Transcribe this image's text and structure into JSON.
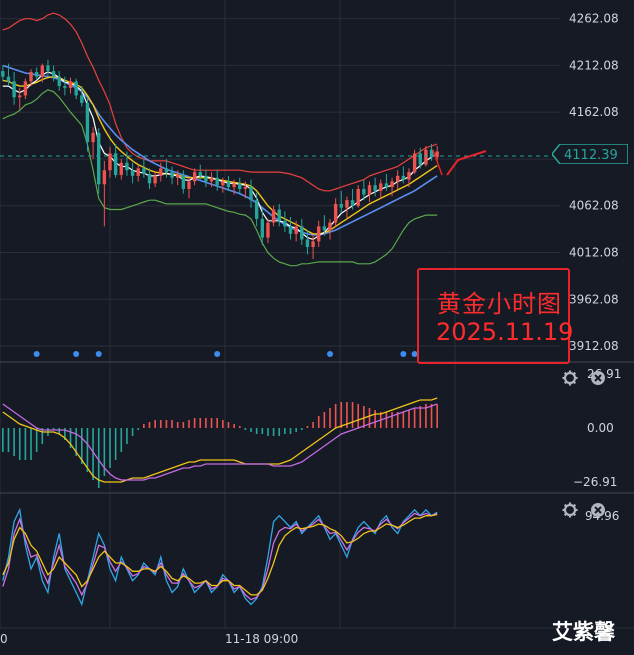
{
  "chart_data": [
    {
      "type": "line",
      "panel": "price",
      "subtitle": "",
      "price_axis_labels": [
        "4262.08",
        "4212.08",
        "4162.08",
        "4112.08",
        "4062.08",
        "4012.08",
        "3962.08",
        "3912.08"
      ],
      "price_axis_values": [
        4262.08,
        4212.08,
        4162.08,
        4112.08,
        4062.08,
        4012.08,
        3962.08,
        3912.08
      ],
      "ylim": [
        3895,
        4282
      ],
      "current_price_label": "4112.39",
      "current_price": 4112.39,
      "candles_ohlc": [
        [
          4206,
          4212,
          4195,
          4200
        ],
        [
          4200,
          4214,
          4190,
          4195
        ],
        [
          4195,
          4205,
          4170,
          4178
        ],
        [
          4178,
          4188,
          4165,
          4180
        ],
        [
          4180,
          4198,
          4176,
          4195
        ],
        [
          4195,
          4208,
          4190,
          4205
        ],
        [
          4205,
          4210,
          4196,
          4200
        ],
        [
          4200,
          4214,
          4194,
          4212
        ],
        [
          4212,
          4218,
          4200,
          4206
        ],
        [
          4206,
          4212,
          4195,
          4200
        ],
        [
          4200,
          4206,
          4185,
          4190
        ],
        [
          4190,
          4200,
          4180,
          4188
        ],
        [
          4188,
          4199,
          4182,
          4195
        ],
        [
          4195,
          4198,
          4176,
          4180
        ],
        [
          4180,
          4190,
          4168,
          4172
        ],
        [
          4172,
          4178,
          4120,
          4130
        ],
        [
          4130,
          4146,
          4112,
          4140
        ],
        [
          4140,
          4145,
          4075,
          4085
        ],
        [
          4085,
          4110,
          4040,
          4100
        ],
        [
          4100,
          4125,
          4092,
          4118
        ],
        [
          4118,
          4128,
          4092,
          4095
        ],
        [
          4095,
          4112,
          4090,
          4108
        ],
        [
          4108,
          4120,
          4094,
          4100
        ],
        [
          4100,
          4108,
          4086,
          4094
        ],
        [
          4094,
          4106,
          4088,
          4102
        ],
        [
          4102,
          4112,
          4092,
          4096
        ],
        [
          4096,
          4102,
          4080,
          4086
        ],
        [
          4086,
          4098,
          4082,
          4094
        ],
        [
          4094,
          4108,
          4088,
          4102
        ],
        [
          4102,
          4112,
          4092,
          4098
        ],
        [
          4098,
          4104,
          4085,
          4092
        ],
        [
          4092,
          4100,
          4084,
          4095
        ],
        [
          4095,
          4100,
          4075,
          4080
        ],
        [
          4080,
          4092,
          4070,
          4088
        ],
        [
          4088,
          4102,
          4084,
          4098
        ],
        [
          4098,
          4106,
          4090,
          4094
        ],
        [
          4094,
          4100,
          4082,
          4088
        ],
        [
          4088,
          4098,
          4082,
          4092
        ],
        [
          4092,
          4100,
          4078,
          4084
        ],
        [
          4084,
          4092,
          4076,
          4088
        ],
        [
          4088,
          4094,
          4078,
          4082
        ],
        [
          4082,
          4090,
          4074,
          4086
        ],
        [
          4086,
          4092,
          4076,
          4080
        ],
        [
          4080,
          4088,
          4070,
          4082
        ],
        [
          4082,
          4090,
          4060,
          4068
        ],
        [
          4068,
          4076,
          4040,
          4048
        ],
        [
          4048,
          4060,
          4020,
          4028
        ],
        [
          4028,
          4048,
          4022,
          4044
        ],
        [
          4044,
          4062,
          4040,
          4058
        ],
        [
          4058,
          4064,
          4040,
          4046
        ],
        [
          4046,
          4056,
          4034,
          4040
        ],
        [
          4040,
          4050,
          4026,
          4032
        ],
        [
          4032,
          4046,
          4024,
          4040
        ],
        [
          4040,
          4048,
          4020,
          4026
        ],
        [
          4026,
          4036,
          4010,
          4018
        ],
        [
          4018,
          4030,
          4005,
          4024
        ],
        [
          4024,
          4046,
          4018,
          4040
        ],
        [
          4040,
          4052,
          4030,
          4036
        ],
        [
          4036,
          4048,
          4026,
          4044
        ],
        [
          4044,
          4070,
          4040,
          4064
        ],
        [
          4064,
          4078,
          4054,
          4060
        ],
        [
          4060,
          4072,
          4048,
          4068
        ],
        [
          4068,
          4080,
          4058,
          4062
        ],
        [
          4062,
          4084,
          4060,
          4080
        ],
        [
          4080,
          4090,
          4068,
          4074
        ],
        [
          4074,
          4088,
          4066,
          4084
        ],
        [
          4084,
          4092,
          4072,
          4078
        ],
        [
          4078,
          4090,
          4070,
          4086
        ],
        [
          4086,
          4096,
          4078,
          4082
        ],
        [
          4082,
          4092,
          4072,
          4088
        ],
        [
          4088,
          4100,
          4080,
          4094
        ],
        [
          4094,
          4104,
          4086,
          4090
        ],
        [
          4090,
          4102,
          4082,
          4098
        ],
        [
          4098,
          4122,
          4096,
          4118
        ],
        [
          4118,
          4124,
          4102,
          4106
        ],
        [
          4106,
          4126,
          4104,
          4122
        ],
        [
          4122,
          4128,
          4110,
          4114
        ],
        [
          4114,
          4126,
          4110,
          4120
        ]
      ],
      "ma_fast": [
        4190,
        4190,
        4186,
        4183,
        4186,
        4192,
        4196,
        4202,
        4205,
        4203,
        4199,
        4194,
        4193,
        4190,
        4185,
        4170,
        4156,
        4130,
        4118,
        4115,
        4108,
        4104,
        4104,
        4100,
        4098,
        4097,
        4094,
        4094,
        4095,
        4097,
        4095,
        4094,
        4090,
        4089,
        4092,
        4094,
        4093,
        4092,
        4090,
        4088,
        4086,
        4086,
        4085,
        4084,
        4080,
        4070,
        4055,
        4046,
        4046,
        4046,
        4044,
        4040,
        4038,
        4033,
        4028,
        4026,
        4030,
        4034,
        4040,
        4047,
        4054,
        4058,
        4062,
        4066,
        4070,
        4074,
        4077,
        4080,
        4082,
        4084,
        4088,
        4090,
        4093,
        4100,
        4105,
        4110,
        4114,
        4118
      ],
      "ma_mid": [
        4196,
        4195,
        4192,
        4190,
        4190,
        4192,
        4194,
        4197,
        4199,
        4200,
        4199,
        4196,
        4194,
        4192,
        4188,
        4180,
        4170,
        4156,
        4144,
        4134,
        4126,
        4120,
        4115,
        4110,
        4106,
        4103,
        4100,
        4098,
        4097,
        4096,
        4096,
        4095,
        4093,
        4092,
        4092,
        4092,
        4092,
        4091,
        4090,
        4089,
        4088,
        4087,
        4086,
        4085,
        4083,
        4078,
        4070,
        4062,
        4056,
        4051,
        4048,
        4045,
        4042,
        4039,
        4035,
        4032,
        4032,
        4033,
        4036,
        4040,
        4044,
        4048,
        4052,
        4056,
        4060,
        4064,
        4067,
        4070,
        4073,
        4076,
        4079,
        4082,
        4085,
        4089,
        4093,
        4097,
        4101,
        4105
      ],
      "ma_slow": [
        4212,
        4210,
        4208,
        4206,
        4204,
        4203,
        4202,
        4201,
        4200,
        4199,
        4197,
        4194,
        4191,
        4188,
        4184,
        4178,
        4170,
        4160,
        4152,
        4145,
        4138,
        4132,
        4127,
        4122,
        4118,
        4114,
        4110,
        4107,
        4104,
        4101,
        4099,
        4097,
        4095,
        4093,
        4091,
        4089,
        4087,
        4085,
        4083,
        4081,
        4079,
        4077,
        4075,
        4072,
        4069,
        4065,
        4060,
        4055,
        4050,
        4046,
        4042,
        4039,
        4036,
        4034,
        4032,
        4031,
        4031,
        4032,
        4034,
        4036,
        4039,
        4042,
        4045,
        4048,
        4051,
        4054,
        4057,
        4060,
        4063,
        4066,
        4069,
        4072,
        4075,
        4078,
        4082,
        4086,
        4090,
        4094
      ],
      "bb_upper": [
        4250,
        4252,
        4256,
        4260,
        4262,
        4262,
        4260,
        4262,
        4266,
        4268,
        4266,
        4262,
        4256,
        4248,
        4236,
        4222,
        4210,
        4196,
        4184,
        4170,
        4150,
        4135,
        4124,
        4118,
        4114,
        4112,
        4110,
        4110,
        4110,
        4110,
        4108,
        4106,
        4104,
        4102,
        4100,
        4100,
        4100,
        4100,
        4100,
        4100,
        4100,
        4100,
        4100,
        4099,
        4098,
        4098,
        4098,
        4098,
        4098,
        4098,
        4097,
        4096,
        4094,
        4092,
        4088,
        4084,
        4080,
        4078,
        4078,
        4080,
        4082,
        4084,
        4086,
        4088,
        4090,
        4094,
        4096,
        4098,
        4100,
        4102,
        4104,
        4108,
        4112,
        4116,
        4120,
        4124,
        4126,
        4128
      ],
      "bb_lower": [
        4155,
        4158,
        4160,
        4164,
        4170,
        4172,
        4176,
        4182,
        4186,
        4184,
        4178,
        4170,
        4162,
        4155,
        4148,
        4128,
        4100,
        4070,
        4060,
        4058,
        4058,
        4058,
        4060,
        4062,
        4064,
        4066,
        4068,
        4068,
        4066,
        4064,
        4064,
        4064,
        4064,
        4064,
        4064,
        4064,
        4064,
        4062,
        4060,
        4058,
        4056,
        4055,
        4053,
        4052,
        4048,
        4036,
        4022,
        4012,
        4006,
        4002,
        4000,
        3998,
        3998,
        4000,
        4000,
        4001,
        4002,
        4002,
        4002,
        4002,
        4002,
        4002,
        4002,
        4000,
        4000,
        4000,
        4002,
        4006,
        4010,
        4016,
        4026,
        4036,
        4044,
        4048,
        4050,
        4052,
        4052,
        4052
      ],
      "signal_markers": 7
    },
    {
      "type": "bar",
      "panel": "macd",
      "axis_labels": [
        "26.91",
        "0.00",
        "−26.91"
      ],
      "axis_values": [
        26.91,
        0.0,
        -26.91
      ],
      "ylim": [
        -30,
        30
      ],
      "histogram": [
        -12,
        -12,
        -14,
        -16,
        -16,
        -16,
        -12,
        -8,
        -4,
        -1,
        -3,
        -6,
        -10,
        -14,
        -18,
        -22,
        -26,
        -30,
        -24,
        -20,
        -16,
        -12,
        -8,
        -4,
        -1,
        2,
        3,
        4,
        4,
        4,
        4,
        3,
        3,
        4,
        5,
        5,
        5,
        5,
        5,
        4,
        3,
        2,
        1,
        -1,
        -2,
        -3,
        -3,
        -4,
        -4,
        -4,
        -3,
        -3,
        -2,
        -1,
        1,
        3,
        6,
        8,
        10,
        12,
        13,
        13,
        13,
        12,
        11,
        10,
        9,
        8,
        8,
        8,
        8,
        8,
        9,
        10,
        11,
        12,
        12,
        12
      ],
      "macd_line": [
        8,
        6,
        4,
        2,
        1,
        0,
        -1,
        -2,
        -2,
        -2,
        -3,
        -5,
        -8,
        -12,
        -16,
        -20,
        -24,
        -26,
        -27,
        -27,
        -27,
        -27,
        -26,
        -25,
        -25,
        -25,
        -24,
        -23,
        -22,
        -21,
        -20,
        -19,
        -18,
        -17,
        -17,
        -16,
        -16,
        -16,
        -16,
        -16,
        -16,
        -16,
        -17,
        -18,
        -18,
        -18,
        -18,
        -18,
        -18,
        -18,
        -17,
        -16,
        -14,
        -12,
        -10,
        -8,
        -6,
        -4,
        -2,
        0,
        1,
        2,
        3,
        4,
        5,
        6,
        7,
        7,
        8,
        9,
        10,
        11,
        12,
        13,
        14,
        14,
        14,
        15
      ],
      "signal_line": [
        12,
        10,
        8,
        6,
        4,
        2,
        0,
        -1,
        -1,
        -1,
        -1,
        -1,
        -2,
        -3,
        -5,
        -8,
        -12,
        -16,
        -20,
        -23,
        -25,
        -26,
        -26,
        -26,
        -26,
        -26,
        -25,
        -25,
        -24,
        -23,
        -22,
        -21,
        -20,
        -20,
        -19,
        -19,
        -18,
        -18,
        -18,
        -18,
        -18,
        -18,
        -18,
        -18,
        -18,
        -18,
        -18,
        -18,
        -19,
        -19,
        -19,
        -19,
        -18,
        -17,
        -15,
        -13,
        -11,
        -9,
        -7,
        -5,
        -3,
        -2,
        -1,
        0,
        1,
        2,
        3,
        4,
        5,
        6,
        7,
        8,
        9,
        10,
        10,
        10,
        11,
        12
      ]
    },
    {
      "type": "line",
      "panel": "kdj",
      "axis_labels": [
        "94.96"
      ],
      "axis_values": [
        94.96
      ],
      "ylim": [
        0,
        110
      ],
      "series_k": [
        40,
        60,
        90,
        100,
        70,
        50,
        60,
        40,
        30,
        60,
        80,
        50,
        40,
        30,
        20,
        40,
        60,
        80,
        70,
        50,
        40,
        60,
        50,
        40,
        45,
        55,
        50,
        45,
        60,
        40,
        30,
        35,
        50,
        40,
        30,
        35,
        40,
        30,
        35,
        45,
        40,
        30,
        35,
        25,
        20,
        25,
        35,
        60,
        90,
        95,
        90,
        85,
        90,
        80,
        85,
        90,
        95,
        85,
        75,
        80,
        70,
        60,
        75,
        85,
        90,
        85,
        80,
        90,
        95,
        85,
        80,
        90,
        95,
        100,
        95,
        100,
        95,
        98
      ],
      "series_d": [
        45,
        55,
        75,
        85,
        80,
        70,
        65,
        55,
        45,
        50,
        60,
        55,
        50,
        45,
        35,
        40,
        50,
        60,
        65,
        60,
        55,
        55,
        52,
        48,
        48,
        50,
        50,
        48,
        52,
        48,
        42,
        40,
        44,
        42,
        38,
        38,
        40,
        36,
        36,
        40,
        40,
        36,
        36,
        32,
        28,
        28,
        32,
        42,
        55,
        70,
        78,
        82,
        85,
        84,
        85,
        86,
        88,
        87,
        84,
        82,
        78,
        72,
        73,
        76,
        80,
        82,
        82,
        85,
        88,
        87,
        85,
        87,
        90,
        93,
        93,
        95,
        95,
        96
      ],
      "series_j": [
        35,
        50,
        80,
        92,
        75,
        60,
        62,
        48,
        38,
        55,
        70,
        52,
        45,
        38,
        28,
        38,
        54,
        70,
        68,
        56,
        48,
        56,
        51,
        44,
        46,
        52,
        50,
        47,
        55,
        45,
        38,
        38,
        46,
        40,
        34,
        36,
        40,
        33,
        35,
        42,
        40,
        33,
        35,
        28,
        24,
        26,
        33,
        50,
        72,
        82,
        85,
        84,
        88,
        82,
        85,
        88,
        92,
        86,
        80,
        81,
        74,
        66,
        74,
        81,
        85,
        84,
        82,
        88,
        92,
        87,
        84,
        89,
        93,
        97,
        95,
        97,
        95,
        97
      ]
    }
  ],
  "x_axis": {
    "labels": [
      "0",
      "11-18 09:00"
    ]
  },
  "annotation": {
    "line1": "黄金小时图",
    "line2": "2025.11.19"
  },
  "watermark": "艾紫馨",
  "colors": {
    "background": "#161a25",
    "grid": "#2a2e39",
    "up": "#ef5350",
    "down": "#26a69a",
    "ma_fast": "#ffffff",
    "ma_mid": "#f0c419",
    "ma_slow": "#5b8def",
    "bb": "#e8423f",
    "bb_lower": "#5aa84a",
    "macd_line": "#f0c419",
    "signal_line": "#c26be2",
    "kdj_k": "#2fa7e8",
    "kdj_d": "#f0c419",
    "kdj_j": "#d070e0",
    "markers": "#3d8cf0",
    "price_tag": "#26a69a",
    "annot": "#ff2c2c"
  },
  "icons": {
    "settings": "gear-icon",
    "close": "close-icon"
  }
}
